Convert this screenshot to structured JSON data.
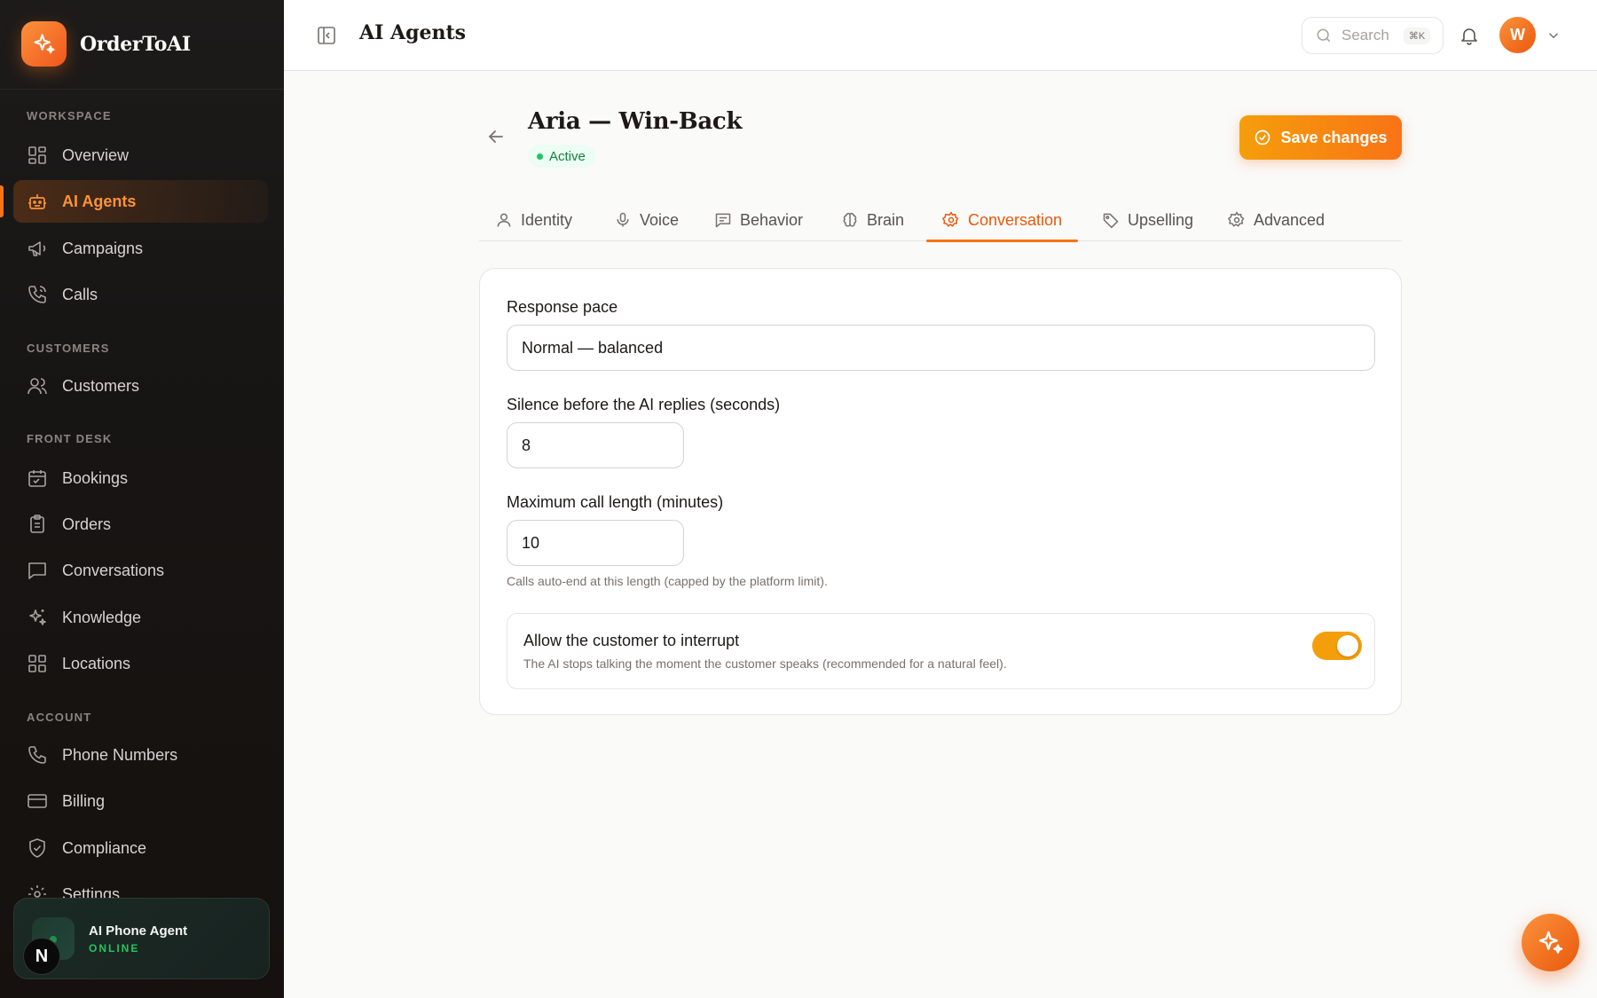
{
  "brand": {
    "name": "OrderToAI",
    "icon": "sparkles-icon"
  },
  "sidebar": {
    "sections": {
      "workspace": "WORKSPACE",
      "customers": "CUSTOMERS",
      "front_desk": "FRONT DESK",
      "account": "ACCOUNT"
    },
    "items": [
      {
        "label": "Overview",
        "icon": "grid-icon",
        "active": false
      },
      {
        "label": "AI Agents",
        "icon": "robot-icon",
        "active": true
      },
      {
        "label": "Campaigns",
        "icon": "megaphone-icon",
        "active": false
      },
      {
        "label": "Calls",
        "icon": "phone-call-icon",
        "active": false
      },
      {
        "label": "Customers",
        "icon": "users-icon",
        "active": false
      },
      {
        "label": "Bookings",
        "icon": "calendar-icon",
        "active": false
      },
      {
        "label": "Orders",
        "icon": "clipboard-icon",
        "active": false
      },
      {
        "label": "Conversations",
        "icon": "message-icon",
        "active": false
      },
      {
        "label": "Knowledge",
        "icon": "sparkles-icon",
        "active": false
      },
      {
        "label": "Locations",
        "icon": "grid-icon",
        "active": false
      },
      {
        "label": "Phone Numbers",
        "icon": "phone-icon",
        "active": false
      },
      {
        "label": "Billing",
        "icon": "credit-card-icon",
        "active": false
      },
      {
        "label": "Compliance",
        "icon": "shield-check-icon",
        "active": false
      },
      {
        "label": "Settings",
        "icon": "gear-icon",
        "active": false
      }
    ],
    "status_card": {
      "title": "AI Phone Agent",
      "status": "ONLINE"
    },
    "badge_letter": "N"
  },
  "topbar": {
    "title": "AI Agents",
    "search_placeholder": "Search",
    "search_shortcut": "⌘K",
    "avatar_initial": "W"
  },
  "agent": {
    "name": "Aria — Win-Back",
    "status": "Active",
    "save_label": "Save changes"
  },
  "tabs": [
    {
      "label": "Identity",
      "icon": "user-icon",
      "active": false
    },
    {
      "label": "Voice",
      "icon": "microphone-icon",
      "active": false
    },
    {
      "label": "Behavior",
      "icon": "chat-icon",
      "active": false
    },
    {
      "label": "Brain",
      "icon": "brain-icon",
      "active": false
    },
    {
      "label": "Conversation",
      "icon": "gear-icon",
      "active": true
    },
    {
      "label": "Upselling",
      "icon": "tag-icon",
      "active": false
    },
    {
      "label": "Advanced",
      "icon": "gear-icon",
      "active": false
    }
  ],
  "form": {
    "response_pace": {
      "label": "Response pace",
      "value": "Normal — balanced"
    },
    "silence": {
      "label": "Silence before the AI replies (seconds)",
      "value": "8"
    },
    "max_call": {
      "label": "Maximum call length (minutes)",
      "value": "10",
      "help": "Calls auto-end at this length (capped by the platform limit)."
    },
    "interrupt": {
      "label": "Allow the customer to interrupt",
      "description": "The AI stops talking the moment the customer speaks (recommended for a natural feel).",
      "enabled": true
    }
  },
  "colors": {
    "accent": "#f97316",
    "accent_light": "#f59e0b",
    "success": "#22c55e",
    "sidebar_bg": "#171514"
  }
}
